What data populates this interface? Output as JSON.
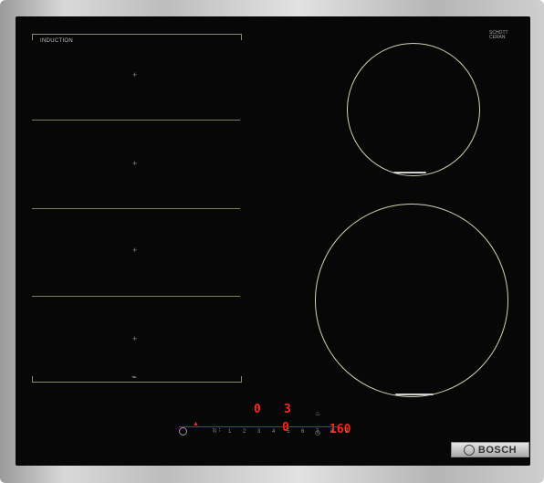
{
  "brand": {
    "name": "BOSCH",
    "logo": "bosch-logo"
  },
  "glass": {
    "top_left_label": "INDUCTION",
    "top_left_sub": "",
    "schott_label": "SCHOTT\nCERAN"
  },
  "left_zone": {
    "crosses": [
      "+",
      "+",
      "+",
      "+"
    ]
  },
  "display": {
    "left_top_digit": "0",
    "right_top_digit": "3",
    "middle_digit": "0",
    "right_temp": "160"
  },
  "power_scale": {
    "labels": [
      "0",
      "1",
      "2",
      "3",
      "4",
      "5",
      "6",
      "7",
      "8",
      "9"
    ]
  },
  "icons": {
    "wifi": "wifi-icon",
    "power": "power-icon",
    "timer": "timer-icon",
    "flex": "flex-zone-icon"
  }
}
